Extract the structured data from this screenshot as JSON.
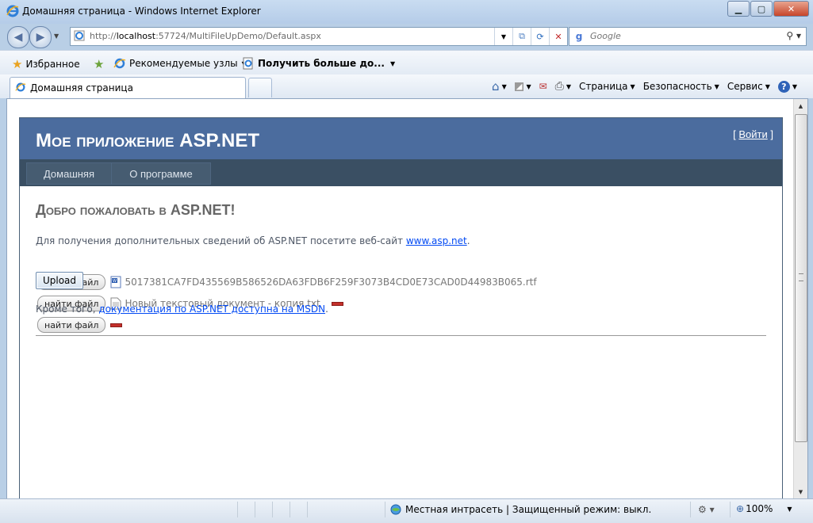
{
  "window": {
    "title": "Домашняя страница - Windows Internet Explorer",
    "controls": [
      "minimize-button",
      "maximize-button",
      "close-button"
    ]
  },
  "address_bar": {
    "url_prefix": "http://",
    "url_host": "localhost",
    "url_rest": ":57724/MultiFileUpDemo/Default.aspx",
    "search_placeholder": "Google"
  },
  "favorites_bar": {
    "favorites_label": "Избранное",
    "recommended_label": "Рекомендуемые узлы",
    "get_more_label": "Получить больше до..."
  },
  "tab": {
    "label": "Домашняя страница"
  },
  "command_bar": {
    "page_label": "Страница",
    "safety_label": "Безопасность",
    "tools_label": "Сервис"
  },
  "site": {
    "title": "Мое приложение ASP.NET",
    "login_open": "[ ",
    "login_label": "Войти",
    "login_close": " ]",
    "menu": [
      {
        "label": "Домашняя"
      },
      {
        "label": "О программе"
      }
    ],
    "heading": "Добро пожаловать в ASP.NET!",
    "intro_text": "Для получения дополнительных сведений об ASP.NET посетите веб-сайт ",
    "intro_link": "www.asp.net",
    "intro_end": ".",
    "file_rows": [
      {
        "button": "найти файл",
        "file": "5017381CA7FD435569B586526DA63FDB6F259F3073B4CD0E73CAD0D44983B065.rtf",
        "icon": "rtf-document-icon",
        "has_delete": false
      },
      {
        "button": "найти файл",
        "file": "Новый текстовый документ - копия.txt",
        "icon": "text-document-icon",
        "has_delete": true
      },
      {
        "button": "найти файл",
        "file": "",
        "icon": "",
        "has_delete": true
      }
    ],
    "upload_label": "Upload",
    "footer_text": "Кроме того, ",
    "footer_link": "документация по ASP.NET доступна на MSDN",
    "footer_end": "."
  },
  "status_bar": {
    "zone_text": "Местная интрасеть | Защищенный режим: выкл.",
    "zoom": "100%"
  },
  "colors": {
    "header_bg": "#4b6c9e",
    "menu_bg": "#3a4f63",
    "link": "#034af3",
    "delete_marker": "#c4302b"
  }
}
